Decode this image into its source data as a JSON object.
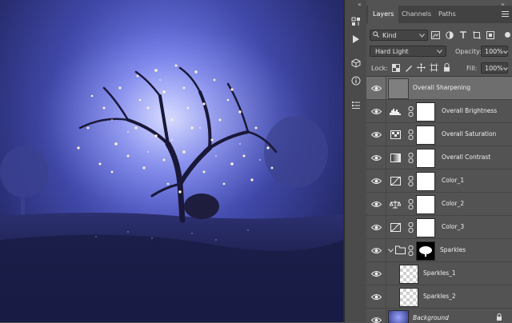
{
  "tabs": [
    {
      "label": "Layers"
    },
    {
      "label": "Channels"
    },
    {
      "label": "Paths"
    }
  ],
  "filter": {
    "kind_label": "Kind"
  },
  "blend": {
    "mode": "Hard Light",
    "opacity_label": "Opacity:",
    "opacity_value": "100%"
  },
  "lock": {
    "label": "Lock:",
    "fill_label": "Fill:",
    "fill_value": "100%"
  },
  "layers": [
    {
      "name": "Overall Sharpening"
    },
    {
      "name": "Overall Brightness"
    },
    {
      "name": "Overall Saturation"
    },
    {
      "name": "Overall Contrast"
    },
    {
      "name": "Color_1"
    },
    {
      "name": "Color_2"
    },
    {
      "name": "Color_3"
    },
    {
      "name": "Sparkles"
    },
    {
      "name": "Sparkles_1"
    },
    {
      "name": "Sparkles_2"
    },
    {
      "name": "Background"
    }
  ],
  "icons": {
    "panel_menu": "panel-menu-icon",
    "collapse": "double-chevron-icon"
  }
}
